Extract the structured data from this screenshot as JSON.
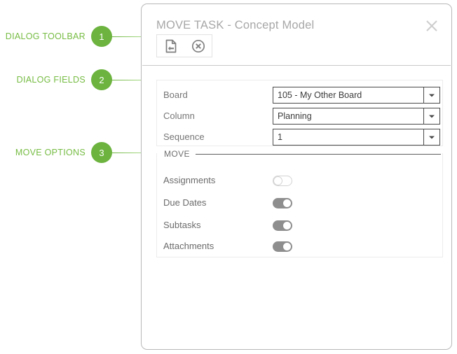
{
  "annotations": [
    {
      "number": "1",
      "label": "DIALOG TOOLBAR"
    },
    {
      "number": "2",
      "label": "DIALOG FIELDS"
    },
    {
      "number": "3",
      "label": "MOVE OPTIONS"
    }
  ],
  "dialog": {
    "title": "MOVE TASK - Concept Model",
    "close_icon": "close-x-icon",
    "toolbar": {
      "buttons": [
        {
          "name": "move-task-icon",
          "tooltip": "Move Task"
        },
        {
          "name": "cancel-circle-x-icon",
          "tooltip": "Cancel"
        }
      ]
    },
    "fields": [
      {
        "label": "Board",
        "value": "105 - My Other Board"
      },
      {
        "label": "Column",
        "value": "Planning"
      },
      {
        "label": "Sequence",
        "value": "1"
      }
    ],
    "options": {
      "legend": "MOVE",
      "items": [
        {
          "label": "Assignments",
          "state": "off"
        },
        {
          "label": "Due Dates",
          "state": "on"
        },
        {
          "label": "Subtasks",
          "state": "on"
        },
        {
          "label": "Attachments",
          "state": "on"
        }
      ]
    }
  },
  "colors": {
    "accent_green": "#6cb33f",
    "label_green": "#76bc43",
    "toggle_on": "#8e8e8e",
    "title_gray": "#a7a7a7"
  }
}
